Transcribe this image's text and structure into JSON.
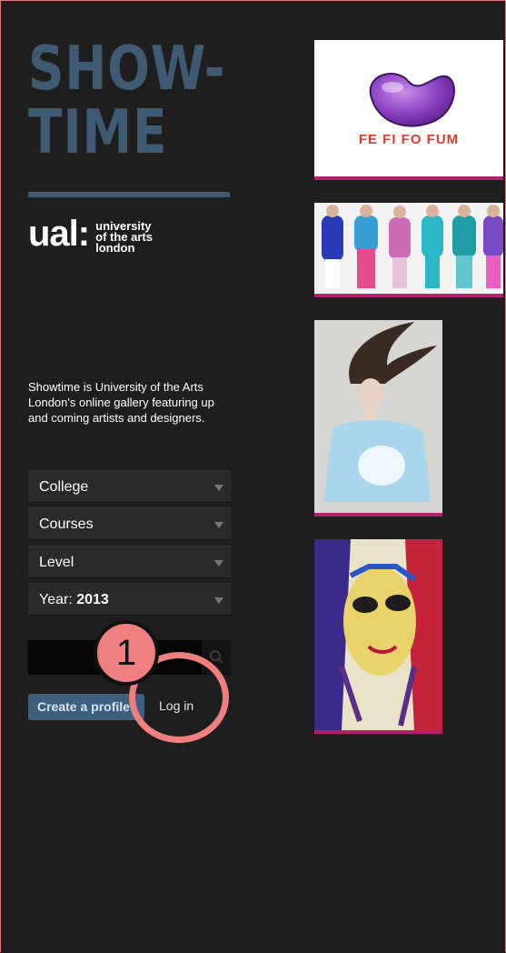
{
  "site": {
    "logo_line1": "SHOW-",
    "logo_line2": "TIME",
    "ual_mark": "ual:",
    "ual_text": [
      "university",
      "of the arts",
      "london"
    ],
    "brand_color": "#3f5a73"
  },
  "intro": {
    "blurb": "Showtime is University of the Arts London's online gallery featuring up and coming artists and designers."
  },
  "filters": [
    {
      "label": "College"
    },
    {
      "label": "Courses"
    },
    {
      "label": "Level"
    },
    {
      "label": "Year:",
      "value": "2013"
    }
  ],
  "search": {
    "value": "",
    "icon": "search-icon"
  },
  "actions": {
    "create_profile": "Create a profile",
    "login": "Log in"
  },
  "annotation": {
    "step": "1",
    "color": "#f08080"
  },
  "gallery": {
    "accent": "#b5206e",
    "items": [
      {
        "caption": "FE FI FO FUM"
      },
      {
        "caption": ""
      },
      {
        "caption": ""
      },
      {
        "caption": ""
      }
    ]
  }
}
